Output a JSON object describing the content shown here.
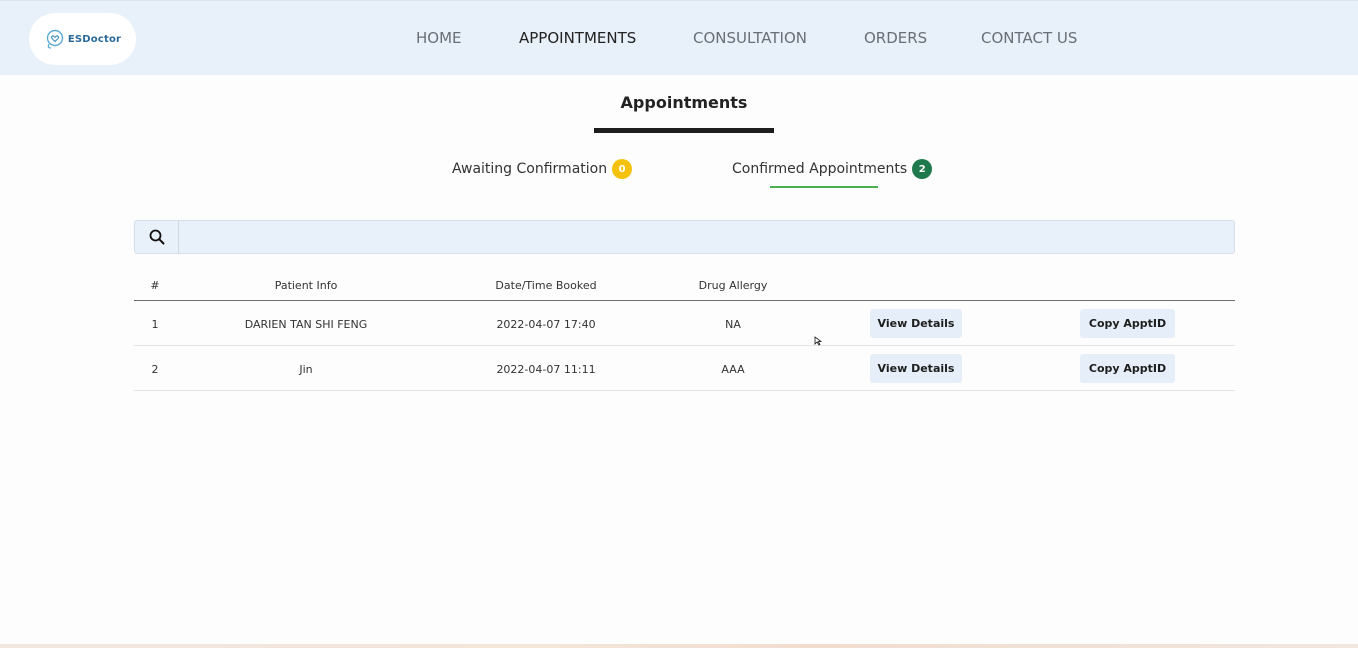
{
  "brand": {
    "name": "ESDoctor",
    "color": "#2a6a9a"
  },
  "nav": {
    "items": [
      {
        "label": "HOME"
      },
      {
        "label": "APPOINTMENTS",
        "active": true
      },
      {
        "label": "CONSULTATION"
      },
      {
        "label": "ORDERS"
      },
      {
        "label": "CONTACT US"
      }
    ]
  },
  "page": {
    "title": "Appointments"
  },
  "tabs": [
    {
      "label": "Awaiting Confirmation",
      "count": "0",
      "badge_color": "#f4c20d"
    },
    {
      "label": "Confirmed Appointments",
      "count": "2",
      "badge_color": "#1e7a4c",
      "active": true
    }
  ],
  "search": {
    "value": "",
    "icon": "search-icon"
  },
  "table": {
    "headers": [
      "#",
      "Patient Info",
      "Date/Time Booked",
      "Drug Allergy"
    ],
    "rows": [
      {
        "index": "1",
        "patient": "DARIEN TAN SHI FENG",
        "booked": "2022-04-07 17:40",
        "allergy": "NA",
        "view_label": "View Details",
        "copy_label": "Copy ApptID"
      },
      {
        "index": "2",
        "patient": "Jin",
        "booked": "2022-04-07 11:11",
        "allergy": "AAA",
        "view_label": "View Details",
        "copy_label": "Copy ApptID"
      }
    ]
  },
  "colors": {
    "navbar_bg": "#e8f0fa",
    "accent_green": "#4caf50"
  }
}
